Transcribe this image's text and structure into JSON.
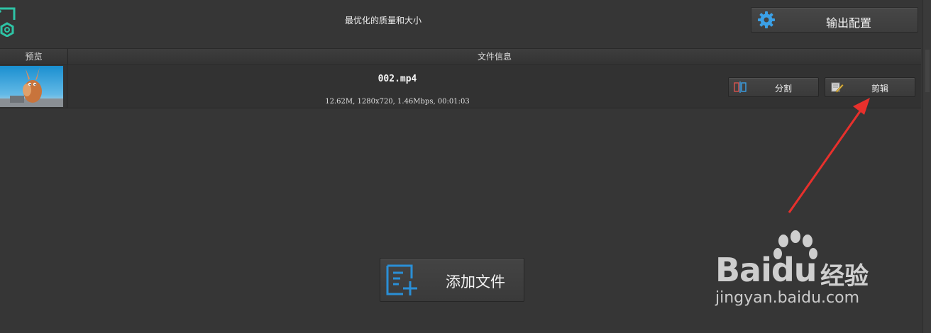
{
  "toolbar": {
    "profile_text": "最优化的质量和大小",
    "output_settings_label": "输出配置"
  },
  "table": {
    "headers": {
      "preview": "预览",
      "file_info": "文件信息"
    },
    "rows": [
      {
        "file_name": "002.mp4",
        "meta": "12.62M, 1280x720, 1.46Mbps, 00:01:03",
        "split_label": "分割",
        "edit_label": "剪辑"
      }
    ]
  },
  "add_file": {
    "label": "添加文件"
  },
  "watermark": {
    "brand": "Baidu",
    "brand_cn": "经验",
    "url": "jingyan.baidu.com"
  },
  "colors": {
    "accent_blue": "#2a8fd6",
    "logo_teal": "#2ec4a6",
    "arrow_red": "#e8302c"
  },
  "icons": [
    "logo-icon",
    "gear-icon",
    "split-icon",
    "edit-icon",
    "add-file-icon"
  ]
}
